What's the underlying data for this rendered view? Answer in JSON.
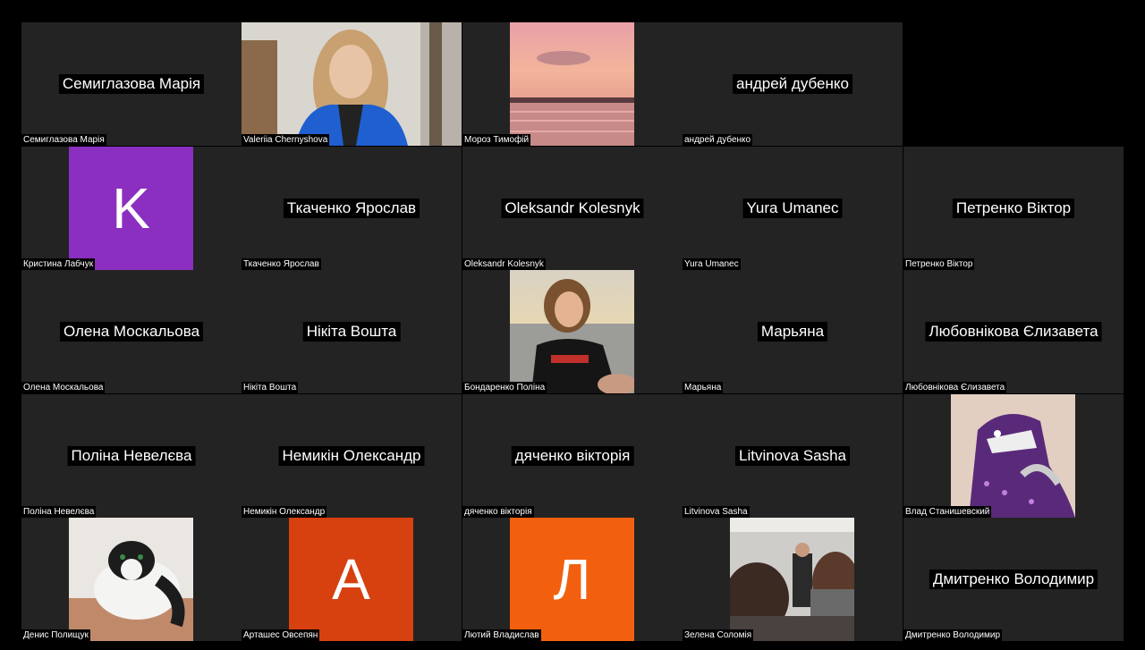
{
  "colors": {
    "tile_bg": "#232323",
    "avatar_purple": "#8b2fc0",
    "avatar_orange_dark": "#d6410f",
    "avatar_orange": "#f2600f"
  },
  "participants": [
    {
      "name": "Семиглазова Марія",
      "tag": "Семиглазова Марія"
    },
    {
      "name": "",
      "tag": "Valeriia Chernyshova"
    },
    {
      "name": "",
      "tag": "Мороз Тимофій"
    },
    {
      "name": "андрей дубенко",
      "tag": "андрей дубенко"
    },
    {
      "name": "",
      "tag": "Кристина Лабчук",
      "avatar_letter": "K"
    },
    {
      "name": "Ткаченко Ярослав",
      "tag": "Ткаченко Ярослав"
    },
    {
      "name": "Oleksandr Kolesnyk",
      "tag": "Oleksandr Kolesnyk"
    },
    {
      "name": "Yura Umanec",
      "tag": "Yura Umanec"
    },
    {
      "name": "Петренко Віктор",
      "tag": "Петренко Віктор"
    },
    {
      "name": "Олена Москальова",
      "tag": "Олена Москальова"
    },
    {
      "name": "Нікіта Вошта",
      "tag": "Нікіта Вошта"
    },
    {
      "name": "",
      "tag": "Бондаренко Поліна"
    },
    {
      "name": "Марьяна",
      "tag": "Марьяна"
    },
    {
      "name": "Любовнікова Єлизавета",
      "tag": "Любовнікова Єлизавета"
    },
    {
      "name": "Поліна Невелєва",
      "tag": "Поліна Невелєва"
    },
    {
      "name": "Немикін Олександр",
      "tag": "Немикін Олександр"
    },
    {
      "name": "дяченко вікторія",
      "tag": "дяченко вікторія"
    },
    {
      "name": "Litvinova Sasha",
      "tag": "Litvinova Sasha"
    },
    {
      "name": "",
      "tag": "Влад Станишевский"
    },
    {
      "name": "",
      "tag": "Денис Полищук"
    },
    {
      "name": "",
      "tag": "Арташес Овсепян",
      "avatar_letter": "A"
    },
    {
      "name": "",
      "tag": "Лютий Владислав",
      "avatar_letter": "Л"
    },
    {
      "name": "",
      "tag": "Зелена Соломія"
    },
    {
      "name": "Дмитренко Володимир",
      "tag": "Дмитренко Володимир"
    }
  ]
}
